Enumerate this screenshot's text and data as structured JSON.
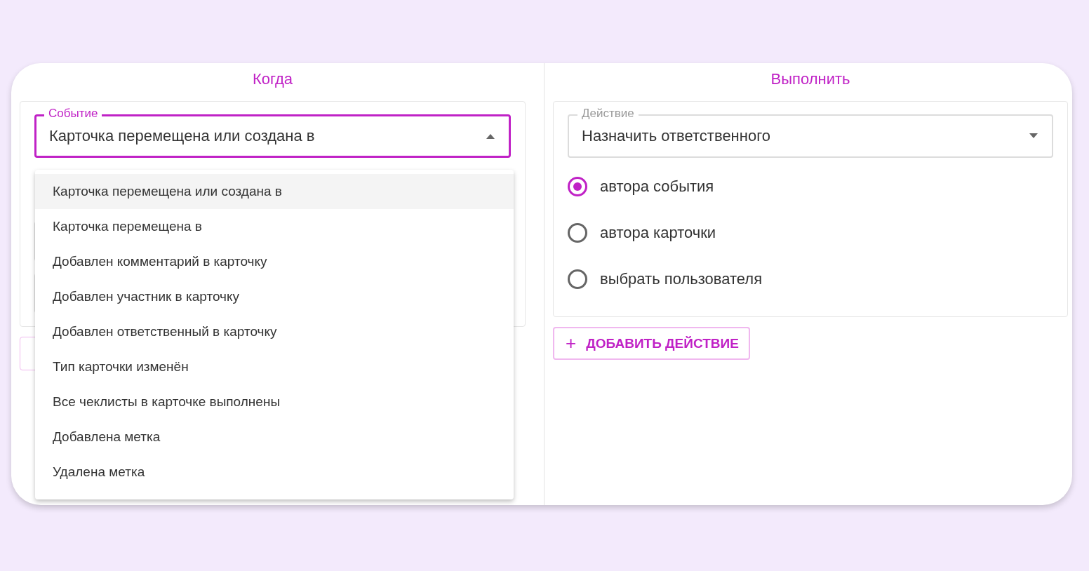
{
  "when": {
    "heading": "Когда",
    "event_select": {
      "label": "Событие",
      "value": "Карточка перемещена или создана в",
      "expanded": true
    },
    "menu": [
      {
        "label": "Карточка перемещена или создана в",
        "selected": true
      },
      {
        "label": "Карточка перемещена в",
        "selected": false
      },
      {
        "label": "Добавлен комментарий в карточку",
        "selected": false
      },
      {
        "label": "Добавлен участник в карточку",
        "selected": false
      },
      {
        "label": "Добавлен ответственный в карточку",
        "selected": false
      },
      {
        "label": "Тип карточки изменён",
        "selected": false
      },
      {
        "label": "Все чеклисты в карточке выполнены",
        "selected": false
      },
      {
        "label": "Добавлена метка",
        "selected": false
      },
      {
        "label": "Удалена метка",
        "selected": false
      }
    ]
  },
  "do": {
    "heading": "Выполнить",
    "action_select": {
      "label": "Действие",
      "value": "Назначить ответственного",
      "expanded": false
    },
    "options": [
      {
        "label": "автора события",
        "selected": true
      },
      {
        "label": "автора карточки",
        "selected": false
      },
      {
        "label": "выбрать пользователя",
        "selected": false
      }
    ],
    "add_button": {
      "icon": "+",
      "label": "ДОБАВИТЬ ДЕЙСТВИЕ"
    }
  }
}
